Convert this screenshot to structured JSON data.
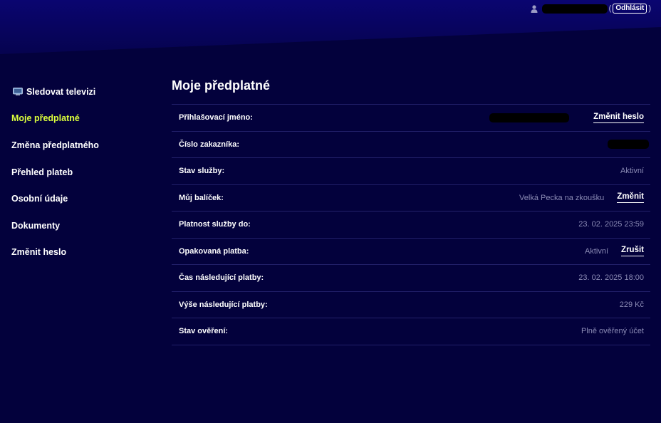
{
  "header": {
    "logout_label": "Odhlásit",
    "paren_open": "(",
    "paren_close": ")"
  },
  "sidebar": {
    "items": [
      {
        "label": "Sledovat televizi",
        "icon": "tv-icon",
        "active": false
      },
      {
        "label": "Moje předplatné",
        "active": true
      },
      {
        "label": "Změna předplatného",
        "active": false
      },
      {
        "label": "Přehled plateb",
        "active": false
      },
      {
        "label": "Osobní údaje",
        "active": false
      },
      {
        "label": "Dokumenty",
        "active": false
      },
      {
        "label": "Změnit heslo",
        "active": false
      }
    ]
  },
  "main": {
    "title": "Moje předplatné",
    "rows": [
      {
        "label": "Přihlašovací jméno:",
        "value": "",
        "action": "Změnit heslo"
      },
      {
        "label": "Číslo zakazníka:",
        "value": ""
      },
      {
        "label": "Stav služby:",
        "value": "Aktivní"
      },
      {
        "label": "Můj balíček:",
        "value": "Velká Pecka na zkoušku",
        "action": "Změnit"
      },
      {
        "label": "Platnost služby do:",
        "value": "23. 02. 2025 23:59"
      },
      {
        "label": "Opakovaná platba:",
        "value": "Aktivní",
        "action": "Zrušit"
      },
      {
        "label": "Čas následující platby:",
        "value": "23. 02. 2025 18:00"
      },
      {
        "label": "Výše následující platby:",
        "value": "229 Kč"
      },
      {
        "label": "Stav ověření:",
        "value": "Plně ověřený účet"
      }
    ]
  },
  "colors": {
    "background": "#03013c",
    "header_top": "#0a0570",
    "active_nav": "#dcff3c",
    "muted_value": "#8b8bb5",
    "divider": "#22206a"
  }
}
